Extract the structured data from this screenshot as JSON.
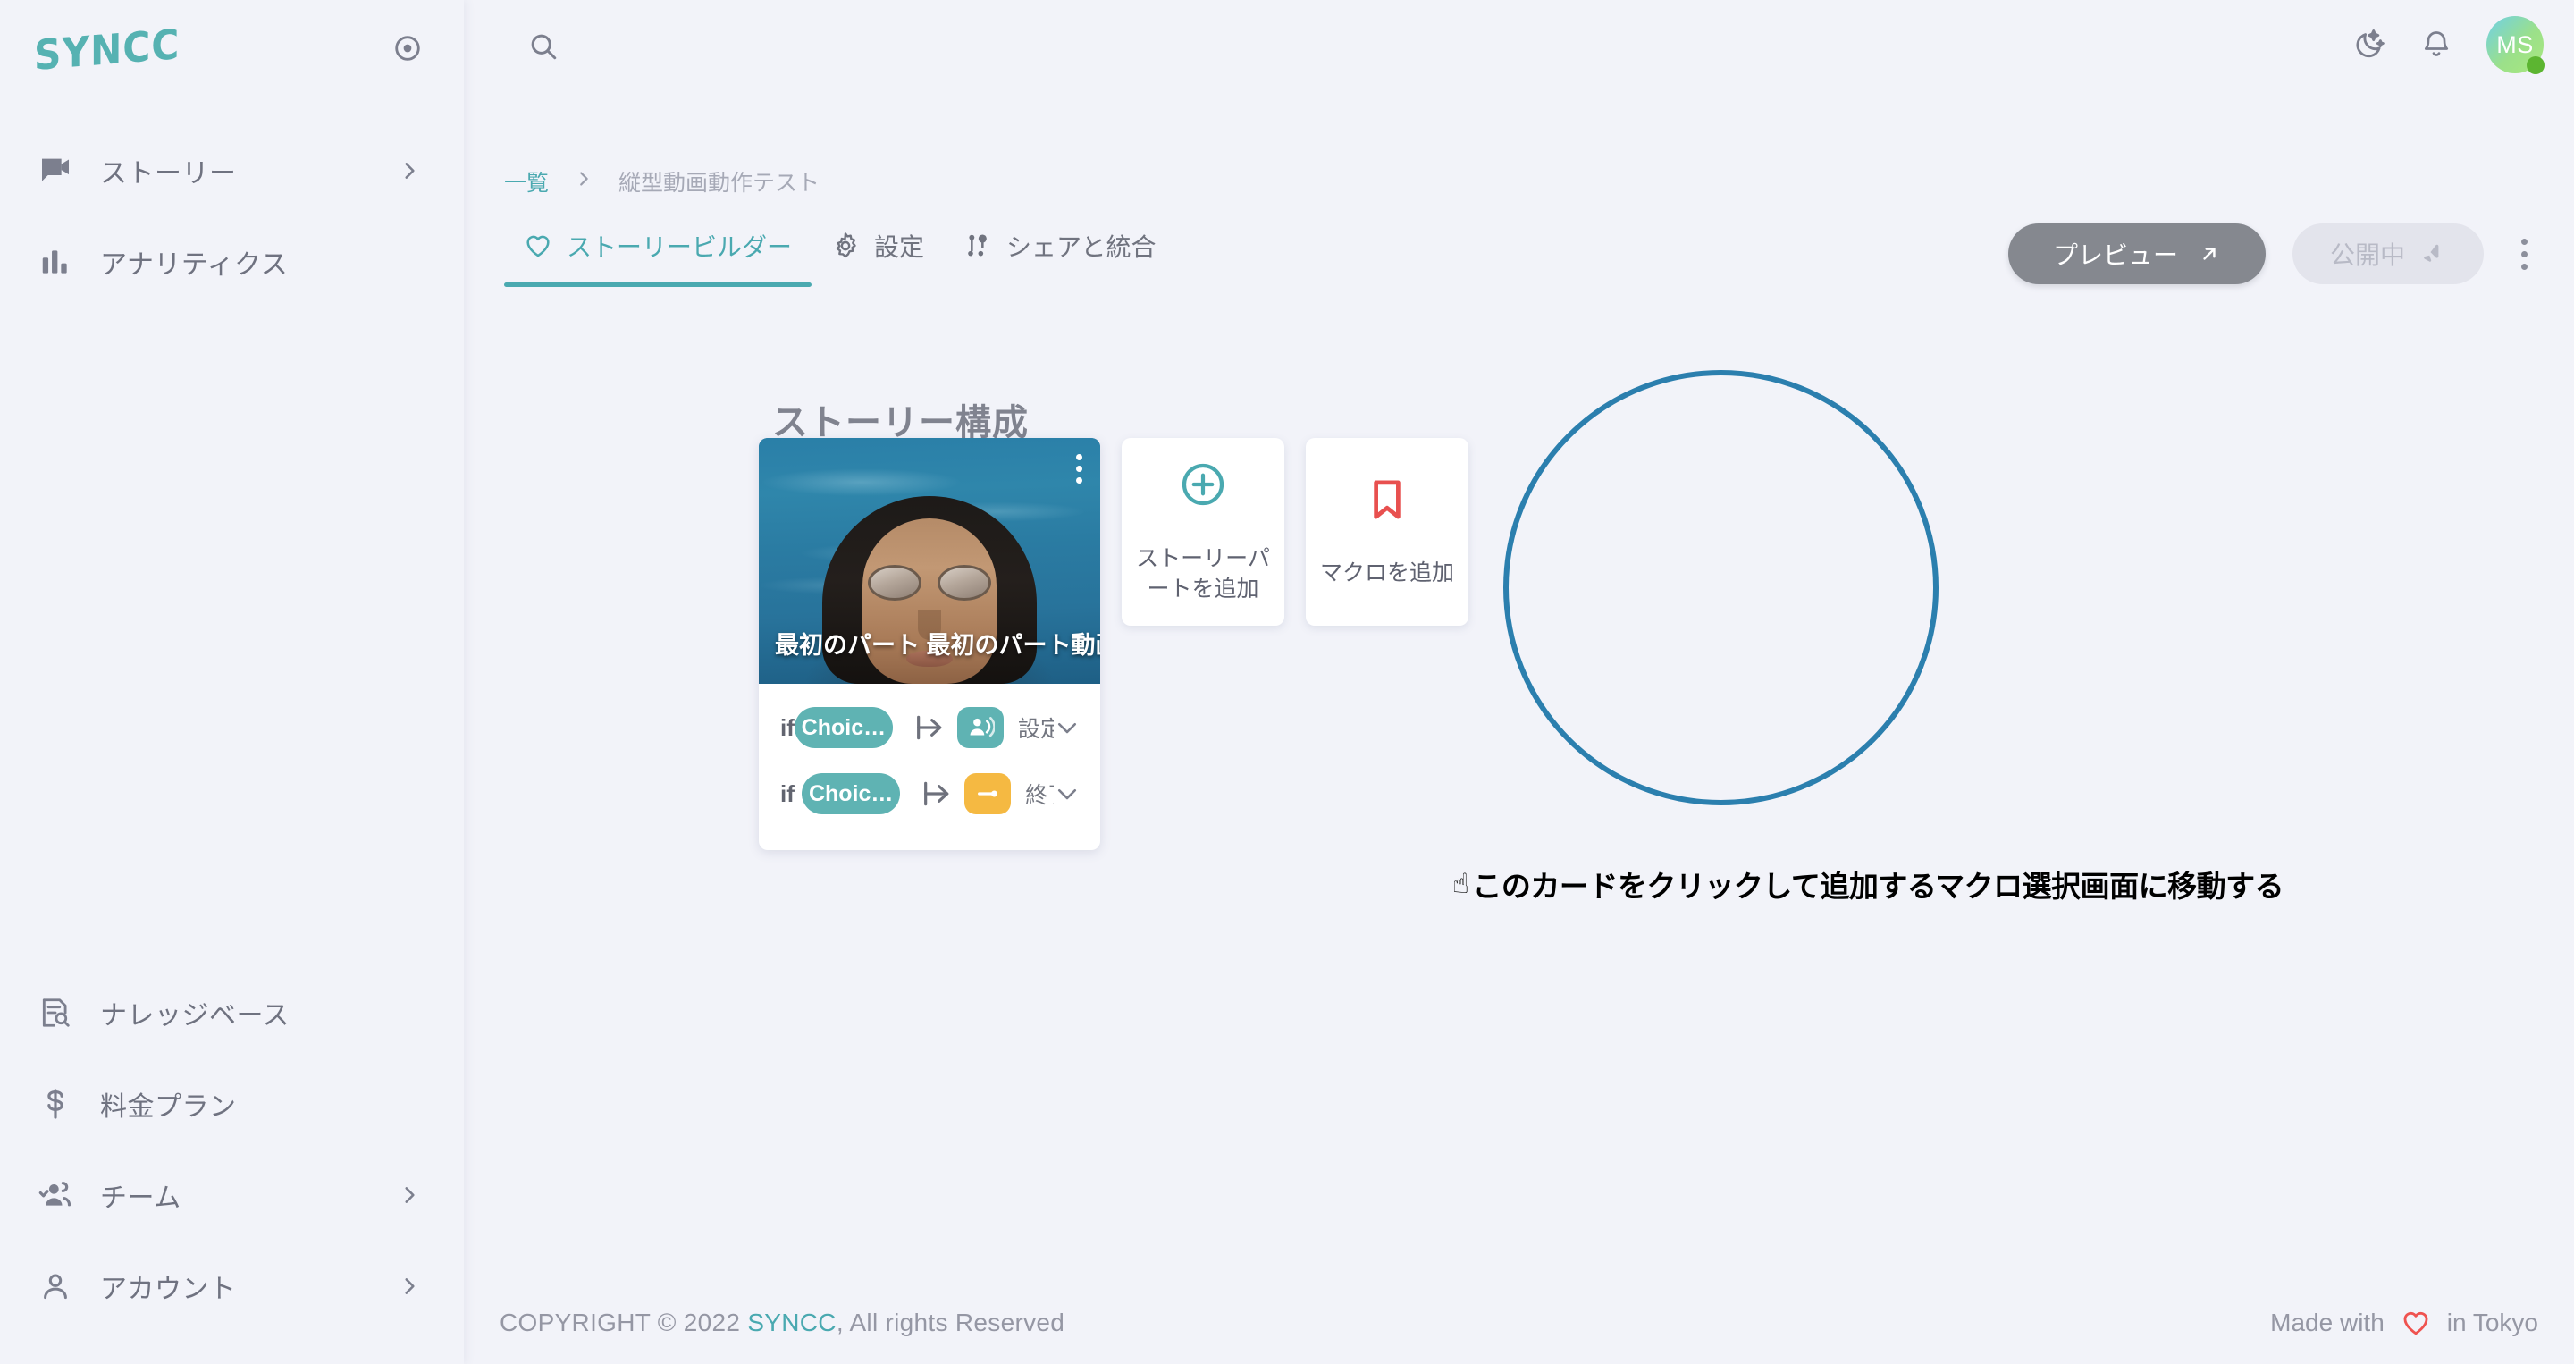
{
  "brand": {
    "logo_text": "SYNCC",
    "accent": "#4aa9b0",
    "logo_color": "#56b2b2"
  },
  "header": {
    "target_icon": "record-target-icon",
    "search_icon": "search-icon",
    "dark_mode_icon": "moon-stars-icon",
    "notifications_icon": "bell-icon",
    "avatar_initials": "MS"
  },
  "sidebar": {
    "top_items": [
      {
        "label": "ストーリー",
        "icon": "video-message-icon",
        "has_chevron": true
      },
      {
        "label": "アナリティクス",
        "icon": "bar-chart-icon",
        "has_chevron": false
      }
    ],
    "bottom_items": [
      {
        "label": "ナレッジベース",
        "icon": "document-search-icon",
        "has_chevron": false
      },
      {
        "label": "料金プラン",
        "icon": "dollar-icon",
        "has_chevron": false
      },
      {
        "label": "チーム",
        "icon": "team-icon",
        "has_chevron": true
      },
      {
        "label": "アカウント",
        "icon": "person-icon",
        "has_chevron": true
      }
    ]
  },
  "breadcrumb": {
    "root": "一覧",
    "separator": "›",
    "current": "縦型動画動作テスト"
  },
  "tabs": [
    {
      "label": "ストーリービルダー",
      "icon": "heart-icon",
      "active": true
    },
    {
      "label": "設定",
      "icon": "gear-icon",
      "active": false
    },
    {
      "label": "シェアと統合",
      "icon": "share-nodes-icon",
      "active": false
    }
  ],
  "actions": {
    "preview_label": "プレビュー",
    "preview_icon": "arrow-up-right-icon",
    "publish_label": "公開中",
    "publish_icon": "megaphone-icon",
    "more_icon": "kebab-menu-icon"
  },
  "section": {
    "title": "ストーリー構成"
  },
  "story_card": {
    "title": "最初のパート 最初のパート動画",
    "kebab_icon": "kebab-menu-icon",
    "conditions": [
      {
        "if_label": "if",
        "chip": "Choic…",
        "arrow_icon": "branch-arrow-icon",
        "badge_icon": "announce-person-icon",
        "badge_color": "#5fb3b3",
        "text": "設定が必…",
        "chevron_icon": "chevron-down-icon"
      },
      {
        "if_label": "if",
        "chip": "Choic…",
        "arrow_icon": "branch-arrow-icon",
        "badge_icon": "end-pin-icon",
        "badge_color": "#f5b942",
        "text": "終了",
        "chevron_icon": "chevron-down-icon"
      }
    ]
  },
  "add_cards": [
    {
      "label": "ストーリーパートを追加",
      "icon": "plus-circle-icon",
      "icon_color": "#4aa9b0"
    },
    {
      "label": "マクロを追加",
      "icon": "bookmark-icon",
      "icon_color": "#e8504f"
    }
  ],
  "annotation": {
    "finger": "☝",
    "text": "このカードをクリックして追加するマクロ選択画面に移動する",
    "circle_color": "#2b7fae"
  },
  "footer": {
    "copyright_prefix": "COPYRIGHT © 2022 ",
    "copyright_brand": "SYNCC",
    "copyright_suffix": ", All rights Reserved",
    "made_prefix": "Made with",
    "made_icon": "heart-icon",
    "made_suffix": "in Tokyo"
  }
}
